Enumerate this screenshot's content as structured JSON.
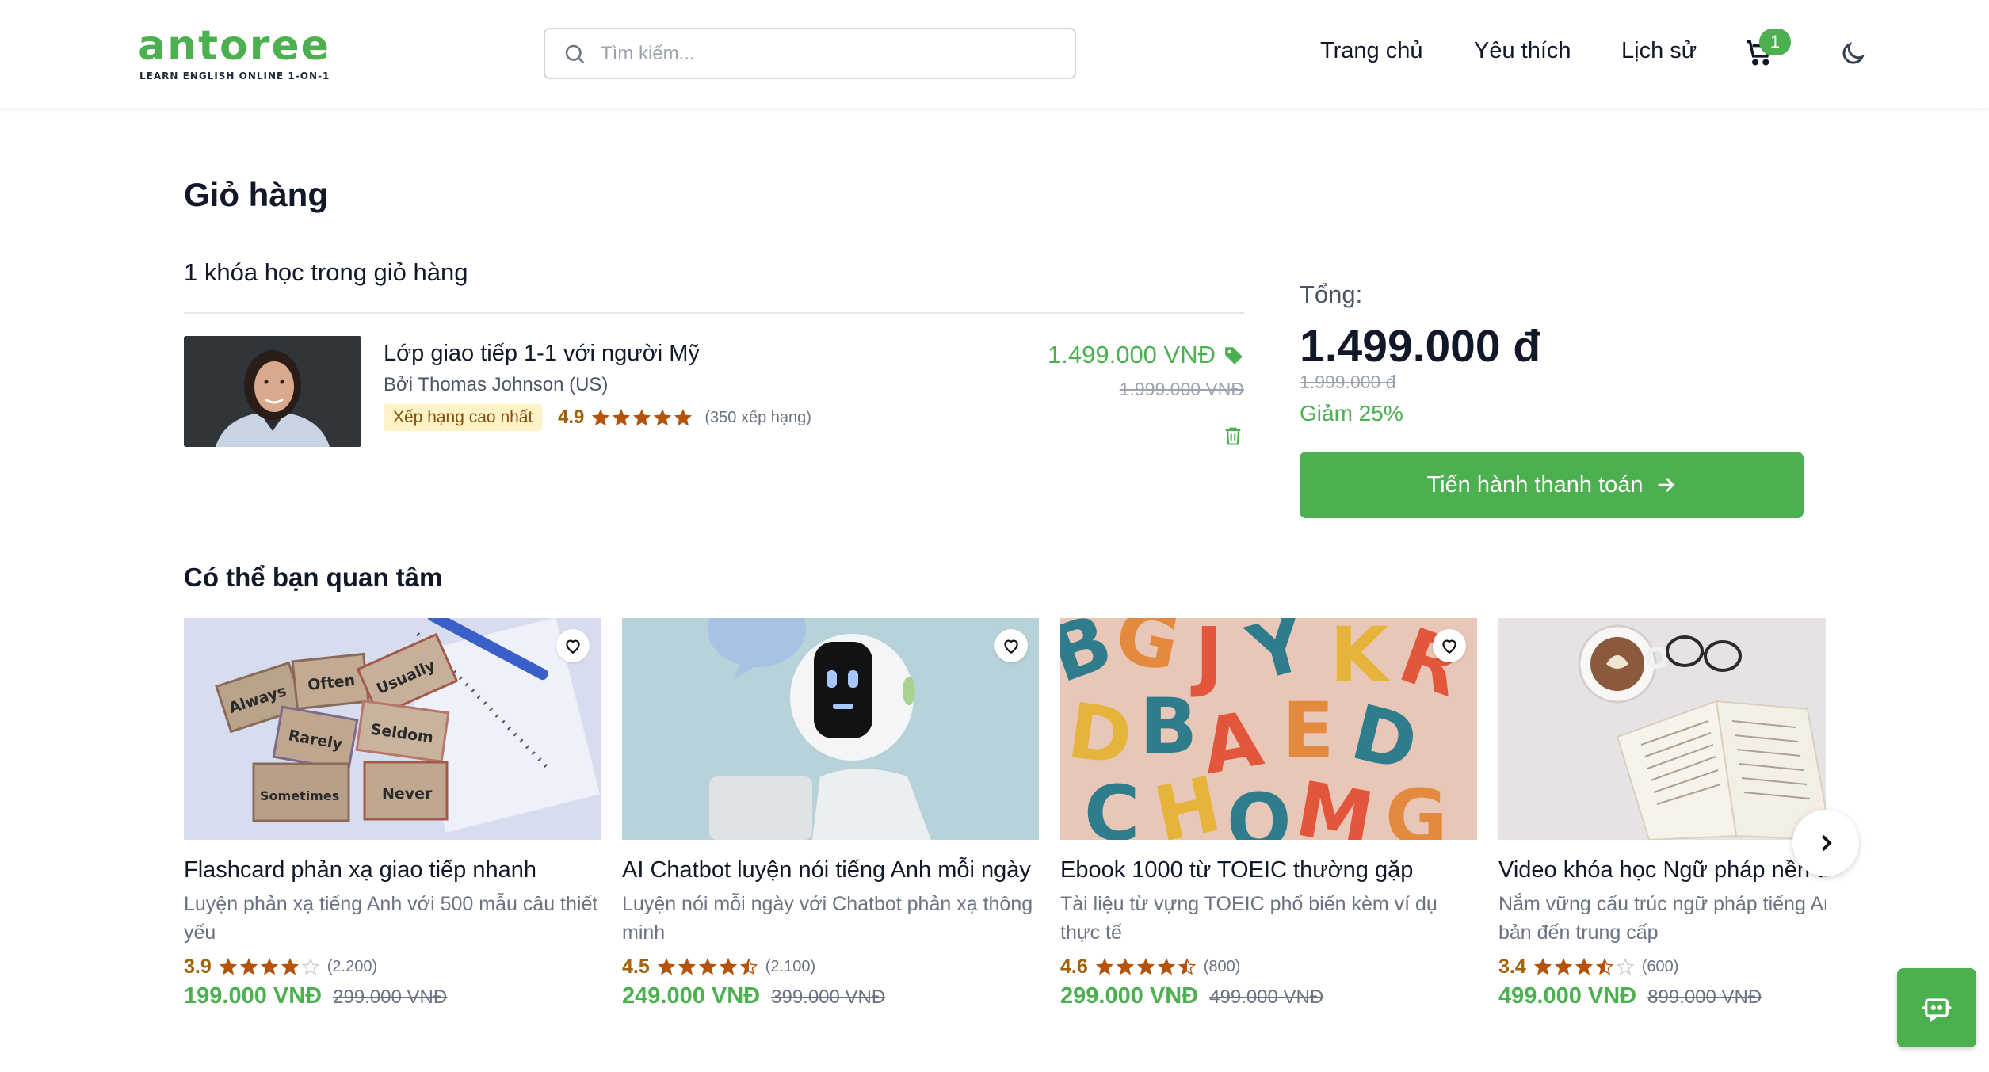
{
  "brand": {
    "name": "antoree",
    "tagline": "LEARN ENGLISH ONLINE 1-ON-1",
    "color": "#4caf50"
  },
  "search": {
    "placeholder": "Tìm kiếm..."
  },
  "nav": {
    "home": "Trang chủ",
    "favorites": "Yêu thích",
    "history": "Lịch sử",
    "cart_count": "1"
  },
  "cart": {
    "title": "Giỏ hàng",
    "count_label": "1 khóa học trong giỏ hàng",
    "items": [
      {
        "title": "Lớp giao tiếp 1-1 với người Mỹ",
        "author": "Bởi Thomas Johnson (US)",
        "badge": "Xếp hạng cao nhất",
        "rating": "4.9",
        "rating_value": 4.9,
        "rating_count": "(350 xếp hạng)",
        "price": "1.499.000 VNĐ",
        "old_price": "1.999.000 VNĐ"
      }
    ]
  },
  "summary": {
    "label": "Tổng:",
    "total": "1.499.000 đ",
    "old_total": "1.999.000 đ",
    "discount": "Giảm 25%",
    "checkout_label": "Tiến hành thanh toán"
  },
  "recommendations": {
    "title": "Có thể bạn quan tâm",
    "items": [
      {
        "title": "Flashcard phản xạ giao tiếp nhanh",
        "desc": "Luyện phản xạ tiếng Anh với 500 mẫu câu thiết yếu",
        "rating": "3.9",
        "rating_value": 3.9,
        "count": "(2.200)",
        "price": "199.000 VNĐ",
        "old_price": "299.000 VNĐ"
      },
      {
        "title": "AI Chatbot luyện nói tiếng Anh mỗi ngày",
        "desc": "Luyện nói mỗi ngày với Chatbot phản xạ thông minh",
        "rating": "4.5",
        "rating_value": 4.5,
        "count": "(2.100)",
        "price": "249.000 VNĐ",
        "old_price": "399.000 VNĐ"
      },
      {
        "title": "Ebook 1000 từ TOEIC thường gặp",
        "desc": "Tài liệu từ vựng TOEIC phổ biến kèm ví dụ thực tế",
        "rating": "4.6",
        "rating_value": 4.6,
        "count": "(800)",
        "price": "299.000 VNĐ",
        "old_price": "499.000 VNĐ"
      },
      {
        "title": "Video khóa học Ngữ pháp nền tảng",
        "desc": "Nắm vững cấu trúc ngữ pháp tiếng Anh từ cơ bản đến trung cấp",
        "rating": "3.4",
        "rating_value": 3.4,
        "count": "(600)",
        "price": "499.000 VNĐ",
        "old_price": "899.000 VNĐ"
      }
    ],
    "flashcard_words": [
      "Always",
      "Often",
      "Usually",
      "Rarely",
      "Seldom",
      "Sometimes",
      "Never"
    ]
  },
  "colors": {
    "accent": "#4caf50",
    "star": "#b45309",
    "badge_bg": "#fef3c7"
  }
}
